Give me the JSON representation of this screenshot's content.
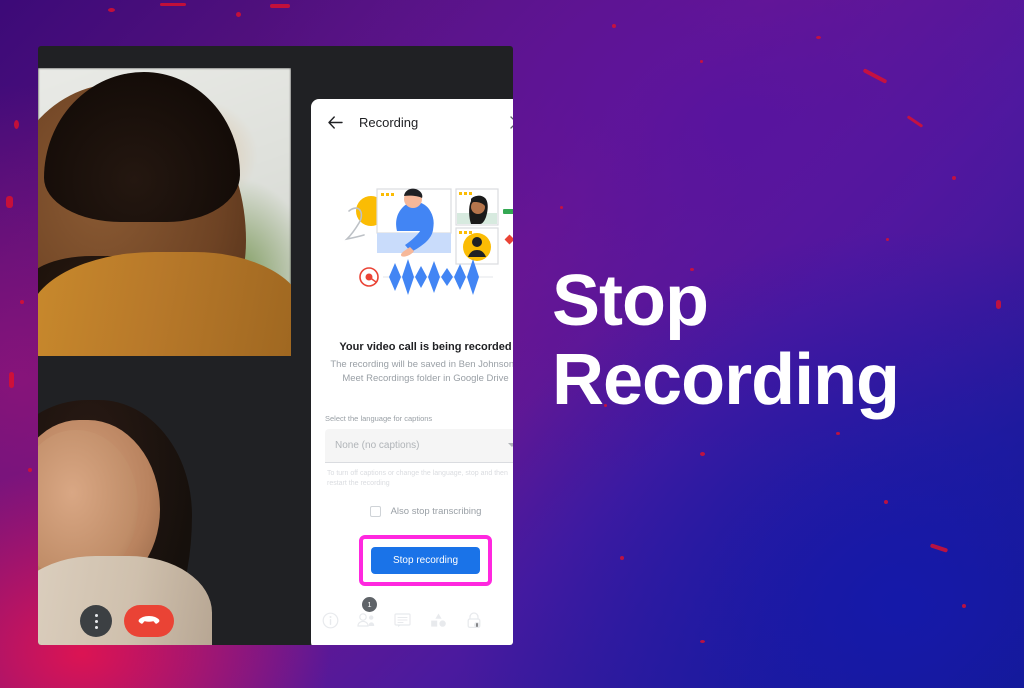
{
  "promo": {
    "line1": "Stop",
    "line2": "Recording"
  },
  "panel": {
    "title": "Recording",
    "back_icon": "back-arrow-icon",
    "close_icon": "close-icon",
    "illustration": "recording-illustration",
    "headline": "Your video call is being recorded",
    "subtext": "The recording will be saved in Ben Johnson's Meet Recordings folder in Google Drive",
    "field_label": "Select the language for captions",
    "select_value": "None (no captions)",
    "helper_text": "To turn off captions or change the language, stop and then restart the recording",
    "checkbox_label": "Also stop transcribing",
    "checkbox_checked": false,
    "stop_button": "Stop recording",
    "highlight_color": "#ff28df",
    "button_color": "#1a73e8"
  },
  "bottom_bar": {
    "items": [
      {
        "name": "meeting-details",
        "icon": "info-icon",
        "badge": ""
      },
      {
        "name": "people",
        "icon": "people-icon",
        "badge": "1"
      },
      {
        "name": "chat",
        "icon": "chat-icon",
        "badge": ""
      },
      {
        "name": "activities",
        "icon": "activities-icon",
        "badge": ""
      },
      {
        "name": "host-controls",
        "icon": "lock-shield-icon",
        "badge": ""
      }
    ]
  },
  "call_controls": {
    "more_options": "more-options-icon",
    "end_call": "end-call-icon"
  },
  "video_tiles": [
    {
      "name": "participant-tile-1"
    },
    {
      "name": "participant-tile-2"
    }
  ]
}
